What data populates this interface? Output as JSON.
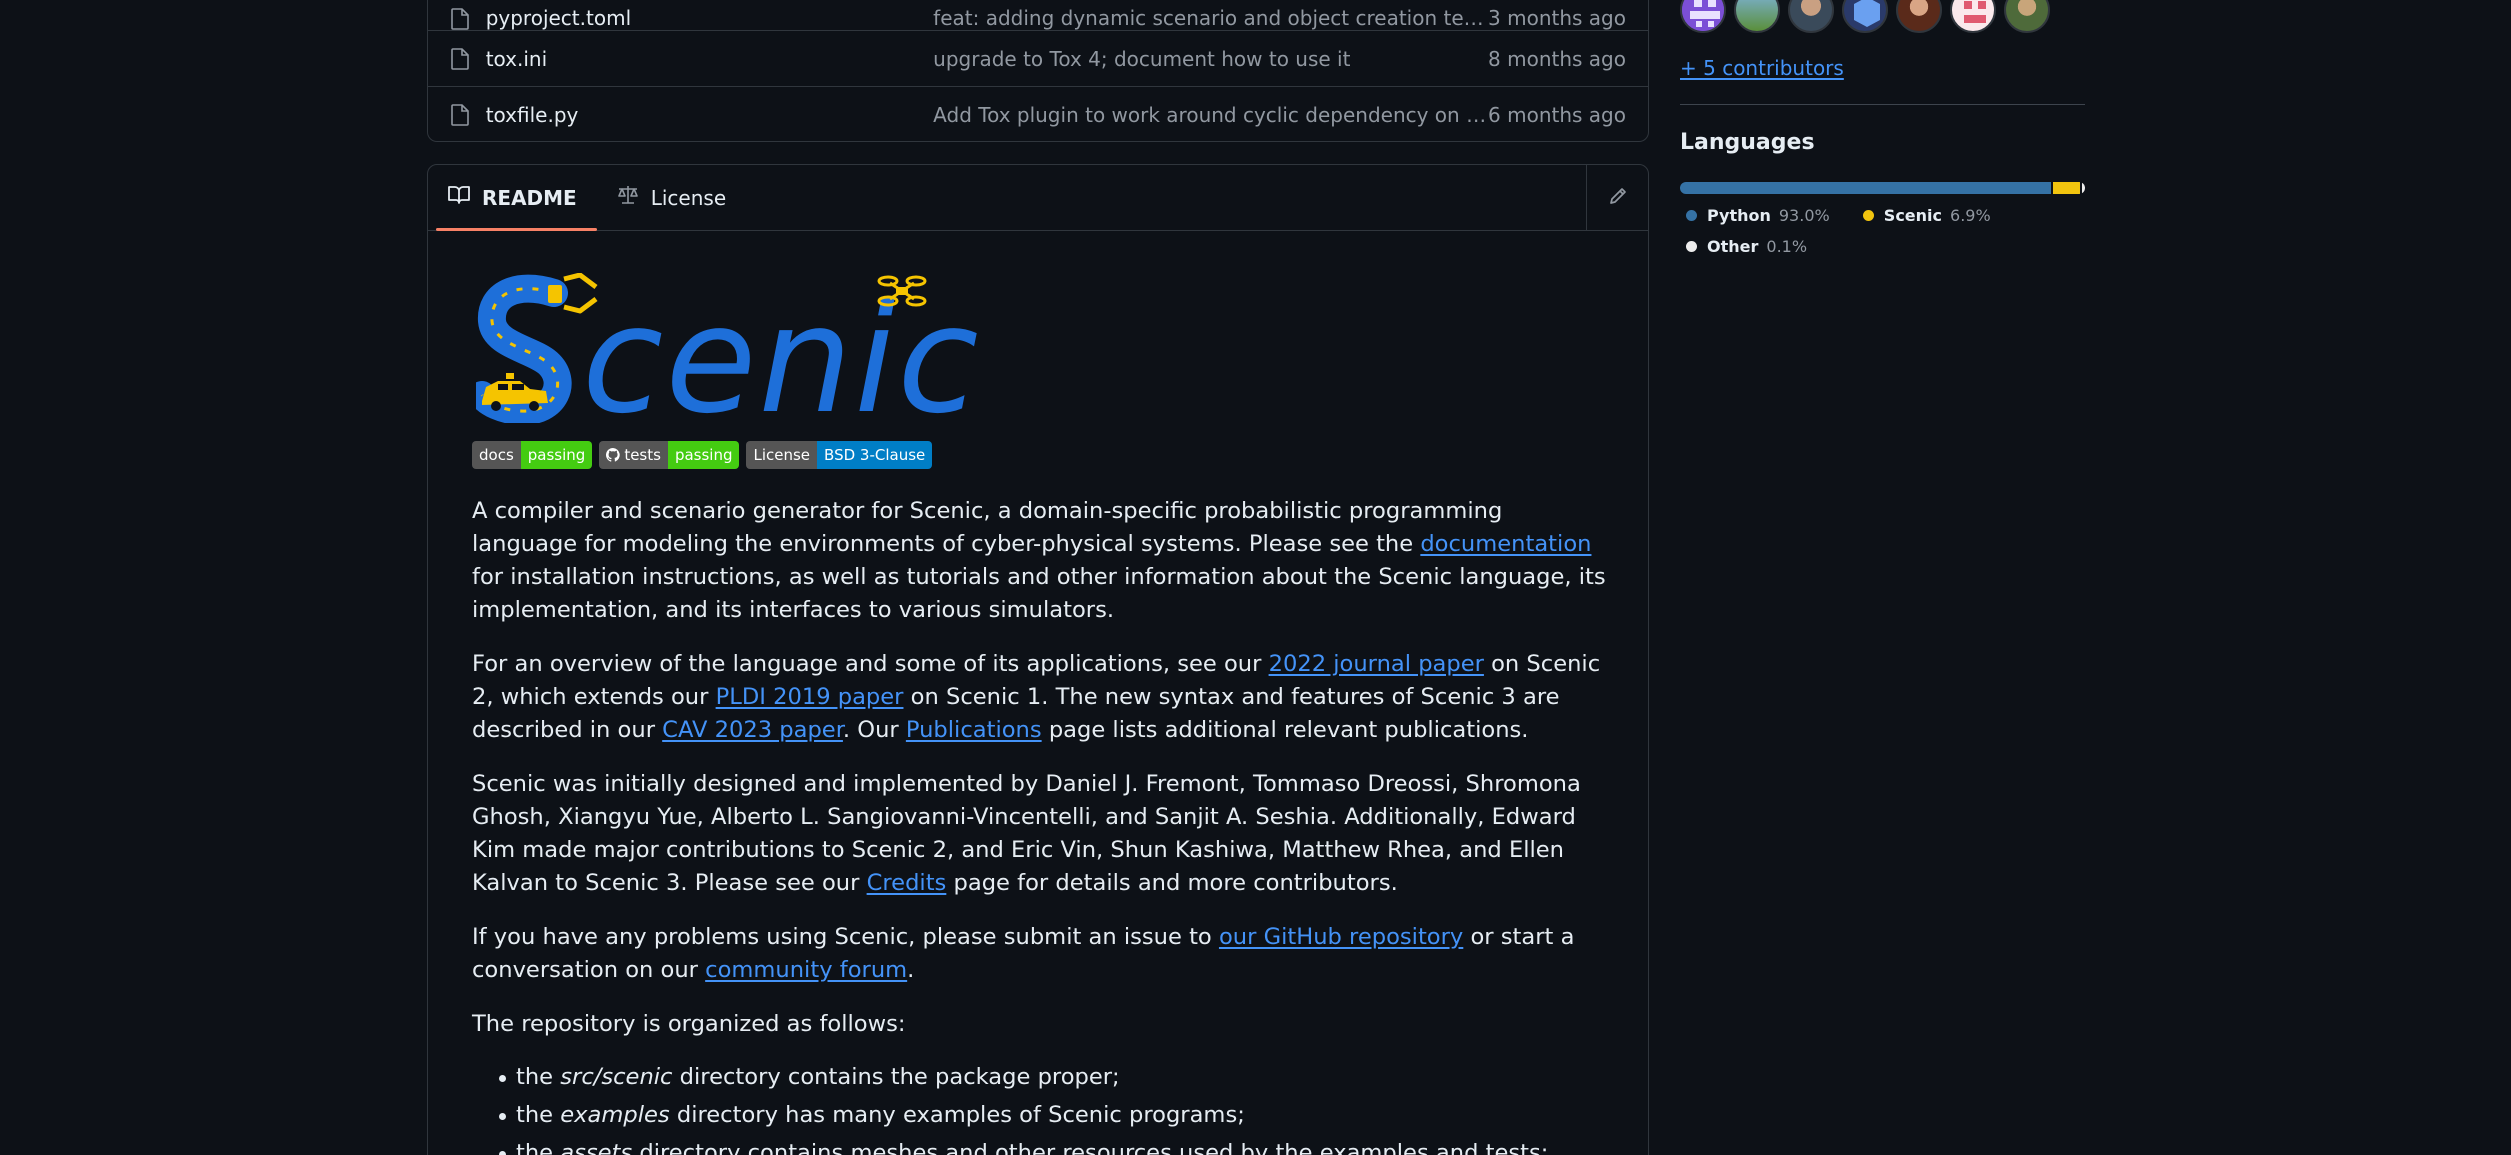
{
  "files": [
    {
      "name": "pyproject.toml",
      "message": "feat: adding dynamic scenario and object creation tests f...",
      "date": "3 months ago"
    },
    {
      "name": "tox.ini",
      "message": "upgrade to Tox 4; document how to use it",
      "date": "8 months ago"
    },
    {
      "name": "toxfile.py",
      "message": "Add Tox plugin to work around cyclic dependency on ver...",
      "date": "6 months ago"
    }
  ],
  "readme": {
    "tabs": [
      {
        "label": "README",
        "icon": "book-icon"
      },
      {
        "label": "License",
        "icon": "scale-icon"
      }
    ],
    "logo_text": "Scenic",
    "badges": [
      {
        "left": "docs",
        "right": "passing",
        "right_color": "#4c1"
      },
      {
        "left": "tests",
        "right": "passing",
        "right_color": "#4c1",
        "icon": "github-icon"
      },
      {
        "left": "License",
        "right": "BSD 3-Clause",
        "right_color": "#007ec6"
      }
    ],
    "p1": {
      "a": "A compiler and scenario generator for Scenic, a domain-specific probabilistic programming language for modeling the environments of cyber-physical systems. Please see the ",
      "link1": "documentation",
      "b": " for installation instructions, as well as tutorials and other information about the Scenic language, its implementation, and its interfaces to various simulators."
    },
    "p2": {
      "a": "For an overview of the language and some of its applications, see our ",
      "link1": "2022 journal paper",
      "b": " on Scenic 2, which extends our ",
      "link2": "PLDI 2019 paper",
      "c": " on Scenic 1. The new syntax and features of Scenic 3 are described in our ",
      "link3": "CAV 2023 paper",
      "d": ". Our ",
      "link4": "Publications",
      "e": " page lists additional relevant publications."
    },
    "p3": {
      "a": "Scenic was initially designed and implemented by Daniel J. Fremont, Tommaso Dreossi, Shromona Ghosh, Xiangyu Yue, Alberto L. Sangiovanni-Vincentelli, and Sanjit A. Seshia. Additionally, Edward Kim made major contributions to Scenic 2, and Eric Vin, Shun Kashiwa, Matthew Rhea, and Ellen Kalvan to Scenic 3. Please see our ",
      "link1": "Credits",
      "b": " page for details and more contributors."
    },
    "p4": {
      "a": "If you have any problems using Scenic, please submit an issue to ",
      "link1": "our GitHub repository",
      "b": " or start a conversation on our ",
      "link2": "community forum",
      "c": "."
    },
    "p5": "The repository is organized as follows:",
    "list": [
      {
        "a": "the ",
        "em": "src/scenic",
        "b": " directory contains the package proper;"
      },
      {
        "a": "the ",
        "em": "examples",
        "b": " directory has many examples of Scenic programs;"
      },
      {
        "a": "the ",
        "em": "assets",
        "b": " directory contains meshes and other resources used by the examples and tests;"
      }
    ]
  },
  "sidebar": {
    "contributors_link": "+ 5 contributors",
    "languages_title": "Languages",
    "languages": [
      {
        "name": "Python",
        "percent": "93.0%",
        "share": 93.0,
        "color": "#3572A5"
      },
      {
        "name": "Scenic",
        "percent": "6.9%",
        "share": 6.9,
        "color": "#f1c40f"
      },
      {
        "name": "Other",
        "percent": "0.1%",
        "share": 0.1,
        "color": "#ededed"
      }
    ]
  }
}
